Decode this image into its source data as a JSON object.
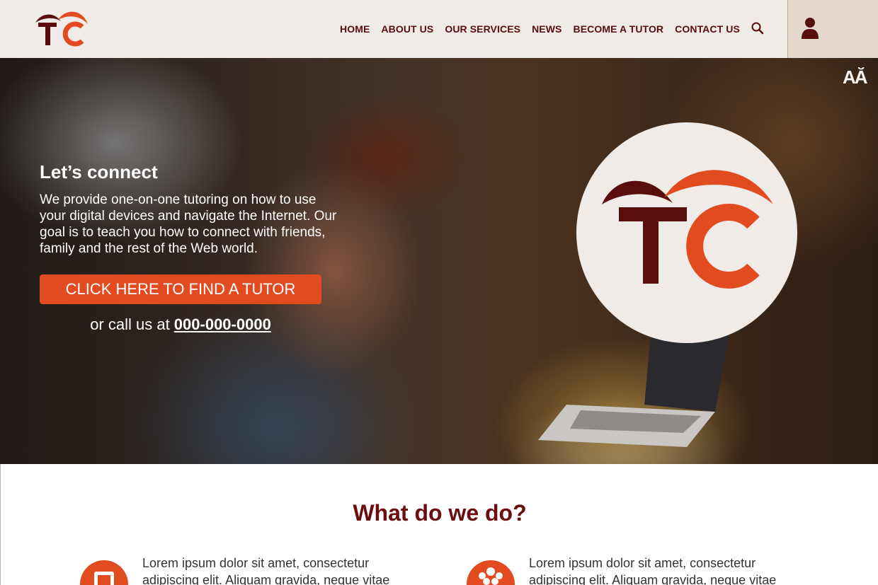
{
  "header": {
    "logo_text": "TC",
    "nav": [
      {
        "label": "HOME"
      },
      {
        "label": "ABOUT US"
      },
      {
        "label": "OUR SERVICES"
      },
      {
        "label": "NEWS"
      },
      {
        "label": "BECOME A TUTOR"
      },
      {
        "label": "CONTACT US"
      }
    ],
    "icons": {
      "search": "search-icon",
      "user": "user-icon",
      "text_size": "text-size-icon"
    }
  },
  "hero": {
    "text_size_label": "AĂ",
    "title": "Let’s connect",
    "description": "We provide one-on-one tutoring on how to use your digital devices and navigate the Internet. Our goal is to teach you how to connect with friends, family and the rest of the Web world.",
    "cta_label": "CLICK HERE TO FIND A TUTOR",
    "call_prefix": "or call us at ",
    "phone": "000-000-0000"
  },
  "what_we_do": {
    "title": "What do we do?",
    "features": [
      {
        "icon": "device-icon",
        "text": "Lorem ipsum dolor sit amet, consectetur adipiscing elit. Aliquam gravida, neque vitae"
      },
      {
        "icon": "people-icon",
        "text": "Lorem ipsum dolor sit amet, consectetur adipiscing elit. Aliquam gravida, neque vitae"
      }
    ]
  },
  "colors": {
    "brand_dark": "#5a0d0d",
    "brand_orange": "#e24a1f",
    "header_bg": "#f0ebe7",
    "account_bg": "#e4d7cb"
  }
}
